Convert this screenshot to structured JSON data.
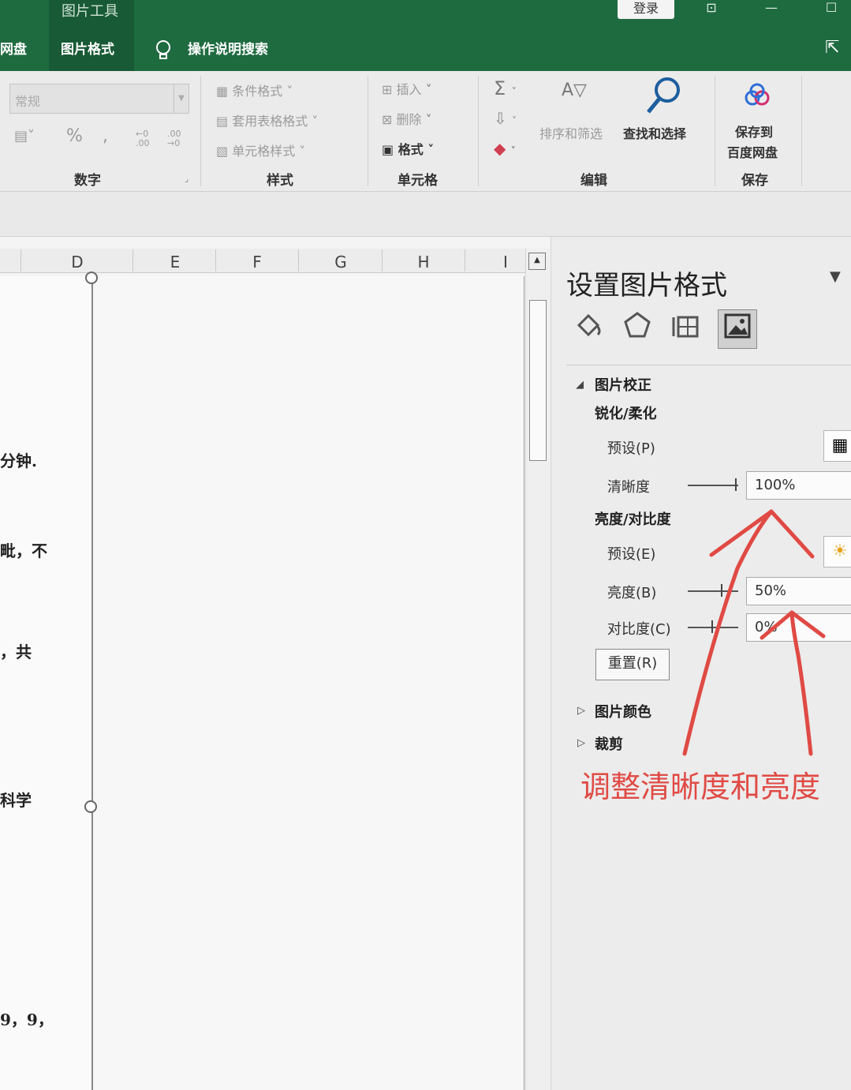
{
  "titlebar": {
    "tool_title": "图片工具",
    "login": "登录",
    "tabs": [
      "网盘",
      "图片格式",
      "操作说明搜索"
    ]
  },
  "ribbon": {
    "number": {
      "format_value": "常规",
      "percent": "%",
      "comma": ",",
      "inc_decimal": "←0 .00",
      "dec_decimal": ".00 →0",
      "label": "数字"
    },
    "styles": {
      "items": [
        "条件格式",
        "套用表格格式",
        "单元格样式"
      ],
      "label": "样式"
    },
    "cells": {
      "items": [
        "插入",
        "删除",
        "格式"
      ],
      "label": "单元格"
    },
    "editing": {
      "sort_filter": "排序和筛选",
      "find_select": "查找和选择",
      "label": "编辑"
    },
    "save": {
      "line1": "保存到",
      "line2": "百度网盘",
      "label": "保存"
    }
  },
  "sheet": {
    "columns": [
      "D",
      "E",
      "F",
      "G",
      "H",
      "I"
    ],
    "doc_fragments": [
      "分钟.",
      "毗，不",
      "，共",
      "科学",
      "9，9，"
    ]
  },
  "pane": {
    "title": "设置图片格式",
    "section_correction": "图片校正",
    "sharpen_soften": "锐化/柔化",
    "preset_p": "预设(P)",
    "sharpness_label": "清晰度",
    "sharpness_value": "100%",
    "brightness_contrast": "亮度/对比度",
    "preset_e": "预设(E)",
    "brightness_label": "亮度(B)",
    "brightness_value": "50%",
    "contrast_label": "对比度(C)",
    "contrast_value": "0%",
    "reset": "重置(R)",
    "section_color": "图片颜色",
    "section_crop": "裁剪"
  },
  "annotation": "调整清晰度和亮度",
  "colors": {
    "titlebar": "#1e6b40",
    "annotation": "#e04a44"
  }
}
